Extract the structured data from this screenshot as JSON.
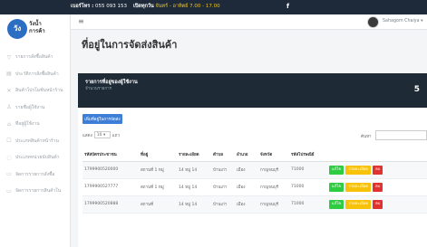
{
  "topbar": {
    "label": "เบอร์โทร :",
    "phone": "055 093 153",
    "hours_label": "เปิดทุกวัน",
    "hours_value": "จันทร์ - อาทิตย์ 7.00 - 17.00",
    "social_icon": "facebook-icon",
    "social_glyph": "f"
  },
  "sidebar": {
    "logo_mark": "วังน้ำ",
    "logo_text": "การค้า",
    "items": [
      {
        "label": "รายการสั่งซื้อสินค้า",
        "icon": "basket-icon"
      },
      {
        "label": "ประวัติการสั่งซื้อสินค้า",
        "icon": "history-icon"
      },
      {
        "label": "สินค้าโปรโมชั่นหน้าร้าน",
        "icon": "tag-icon"
      },
      {
        "label": "รายชื่อผู้ใช้งาน",
        "icon": "user-icon"
      },
      {
        "label": "ที่อยู่ผู้ใช้งาน",
        "icon": "address-icon"
      },
      {
        "label": "ประเภทสินค้าหน้าร้าน",
        "icon": "category-icon"
      },
      {
        "label": "ประเภทหน่วยนับสินค้า",
        "icon": "unit-icon"
      },
      {
        "label": "จัดการรายการสั่งซื้อ",
        "icon": "order-icon"
      },
      {
        "label": "จัดการรายการสินค้าใน",
        "icon": "stock-icon"
      }
    ]
  },
  "header": {
    "menu_glyph": "≡",
    "username": "Sahagom Chaiya"
  },
  "page": {
    "title": "ที่อยู่ในการจัดส่งสินค้า"
  },
  "stat": {
    "title": "รายการที่อยู่ของผู้ใช้งาน",
    "subtitle": "จำนวนรายการ",
    "value": "5"
  },
  "panel": {
    "add_label": "เพิ่มที่อยู่ในการจัดส่ง",
    "show_label": "แสดง",
    "entries_value": "10",
    "entries_suffix": "แถว",
    "search_label": "ค้นหา",
    "search_placeholder": ""
  },
  "table": {
    "columns": [
      "รหัสบัตรประชาชน",
      "ที่อยู่",
      "รายละเอียด",
      "ตำบล",
      "อำเภอ",
      "จังหวัด",
      "รหัสไปรษณีย์",
      ""
    ],
    "rows": [
      {
        "id": "1799900520000",
        "addr": "สถานที่ 1 หมู่",
        "detail": "14 หมู่ 14",
        "subdistrict": "บ้านเก่า",
        "district": "เมือง",
        "province": "กาญจนบุรี",
        "zip": "71000"
      },
      {
        "id": "1799900527777",
        "addr": "สถานที่ 1 หมู่",
        "detail": "14 หมู่ 14",
        "subdistrict": "บ้านเก่า",
        "district": "เมือง",
        "province": "กาญจนบุรี",
        "zip": "71000"
      },
      {
        "id": "1799900520888",
        "addr": "สถานที่",
        "detail": "14 หมู่ 14",
        "subdistrict": "บ้านเก่า",
        "district": "เมือง",
        "province": "กาญจนบุรี",
        "zip": "71000"
      }
    ],
    "actions": {
      "edit": "แก้ไข",
      "detail": "รายละเอียด",
      "delete": "ลบ"
    }
  },
  "colors": {
    "topbar": "#1e2a3a",
    "stat_card": "#1e2b36",
    "primary": "#3d7ed6",
    "edit": "#2ecc40",
    "detail": "#f9c20a",
    "delete": "#e0332f"
  }
}
